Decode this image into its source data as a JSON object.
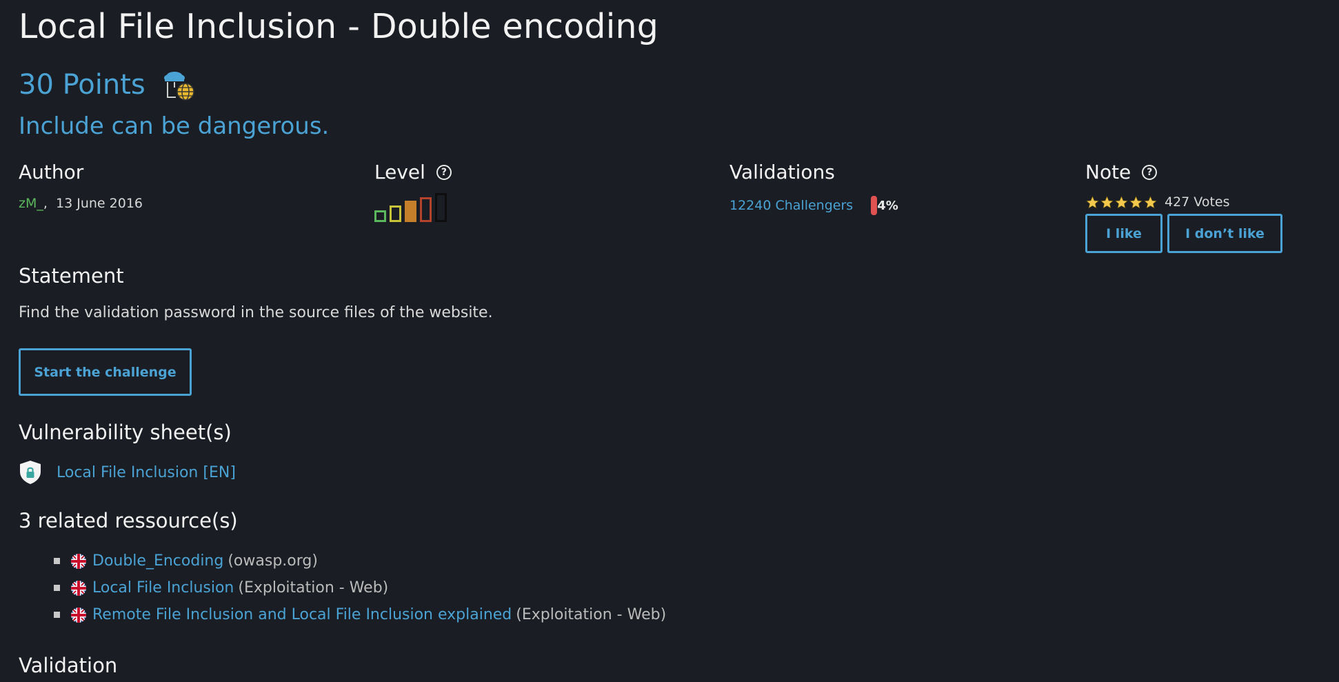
{
  "challenge": {
    "title": "Local File Inclusion - Double encoding",
    "points": "30 Points",
    "category_icon": "web-server-cloud-icon",
    "tagline": "Include can be dangerous."
  },
  "author": {
    "heading": "Author",
    "name": "zM_",
    "separator": ",",
    "date": "13 June 2016"
  },
  "level": {
    "heading": "Level",
    "help": "?",
    "current_level": 4,
    "max_level": 5,
    "colors": [
      "#5cb85c",
      "#c7c43a",
      "#c57f2b",
      "#b5432c",
      "#111111"
    ]
  },
  "validations": {
    "heading": "Validations",
    "challengers": "12240 Challengers",
    "percent": "4%",
    "percent_value": 4,
    "bar_color": "#e05252"
  },
  "note": {
    "heading": "Note",
    "help": "?",
    "stars": 5,
    "star_color": "#f2c94c",
    "votes": "427 Votes",
    "like_label": "I like",
    "dislike_label": "I don’t like"
  },
  "statement": {
    "heading": "Statement",
    "text": "Find the validation password in the source files of the website.",
    "start_label": "Start the challenge"
  },
  "vulnerability": {
    "heading": "Vulnerability sheet(s)",
    "icon": "shield-lock-icon",
    "link": "Local File Inclusion [EN]"
  },
  "resources": {
    "heading": "3 related ressource(s)",
    "items": [
      {
        "flag": "uk-flag-icon",
        "link": "Double_Encoding",
        "source": "(owasp.org)"
      },
      {
        "flag": "uk-flag-icon",
        "link": "Local File Inclusion",
        "source": "(Exploitation - Web)"
      },
      {
        "flag": "uk-flag-icon",
        "link": "Remote File Inclusion and Local File Inclusion explained",
        "source": "(Exploitation - Web)"
      }
    ]
  },
  "validation": {
    "heading": "Validation"
  },
  "colors": {
    "background": "#1a1d23",
    "accent": "#4aa3d4",
    "author": "#5cb85c"
  }
}
